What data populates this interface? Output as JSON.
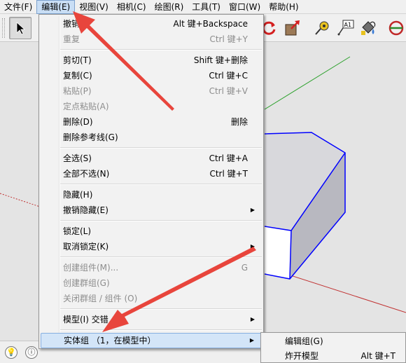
{
  "menubar": {
    "items": [
      {
        "label": "文件(F)"
      },
      {
        "label": "编辑(E)"
      },
      {
        "label": "视图(V)"
      },
      {
        "label": "相机(C)"
      },
      {
        "label": "绘图(R)"
      },
      {
        "label": "工具(T)"
      },
      {
        "label": "窗口(W)"
      },
      {
        "label": "帮助(H)"
      }
    ]
  },
  "toolbar": {
    "icons": [
      "select-arrow-icon",
      "orbit-icon",
      "push-pull-icon",
      "tape-measure-icon",
      "text-label-icon",
      "paint-bucket-icon",
      "rotate-icon"
    ],
    "text_tool_label": "A1"
  },
  "edit_menu": {
    "items": [
      {
        "label": "撤销组",
        "shortcut": "Alt 键+Backspace",
        "disabled": false
      },
      {
        "label": "重复",
        "shortcut": "Ctrl 键+Y",
        "disabled": true
      },
      {
        "label": "剪切(T)",
        "shortcut": "Shift 键+删除",
        "disabled": false
      },
      {
        "label": "复制(C)",
        "shortcut": "Ctrl 键+C",
        "disabled": false
      },
      {
        "label": "粘贴(P)",
        "shortcut": "Ctrl 键+V",
        "disabled": true
      },
      {
        "label": "定点粘贴(A)",
        "shortcut": "",
        "disabled": true
      },
      {
        "label": "删除(D)",
        "shortcut": "删除",
        "disabled": false
      },
      {
        "label": "删除参考线(G)",
        "shortcut": "",
        "disabled": false
      },
      {
        "label": "全选(S)",
        "shortcut": "Ctrl 键+A",
        "disabled": false
      },
      {
        "label": "全部不选(N)",
        "shortcut": "Ctrl 键+T",
        "disabled": false
      },
      {
        "label": "隐藏(H)",
        "shortcut": "",
        "disabled": false
      },
      {
        "label": "撤销隐藏(E)",
        "shortcut": "",
        "disabled": false,
        "submenu": true
      },
      {
        "label": "锁定(L)",
        "shortcut": "",
        "disabled": false
      },
      {
        "label": "取消锁定(K)",
        "shortcut": "",
        "disabled": false,
        "submenu": true
      },
      {
        "label": "创建组件(M)...",
        "shortcut": "G",
        "disabled": true
      },
      {
        "label": "创建群组(G)",
        "shortcut": "",
        "disabled": true
      },
      {
        "label": "关闭群组 / 组件 (O)",
        "shortcut": "",
        "disabled": true
      },
      {
        "label": "模型(I) 交错",
        "shortcut": "",
        "disabled": false,
        "submenu": true
      },
      {
        "label": "实体组 （1，在模型中）",
        "shortcut": "",
        "disabled": false,
        "submenu": true,
        "highlighted": true
      }
    ]
  },
  "submenu": {
    "items": [
      {
        "label": "编辑组(G)",
        "shortcut": ""
      },
      {
        "label": "炸开模型",
        "shortcut": "Alt 键+T"
      }
    ]
  },
  "statusbar": {
    "icons": [
      "hint-bulb-icon",
      "info-icon"
    ]
  },
  "colors": {
    "annotation_arrow": "#e8453c",
    "selection_edge": "#0000ff",
    "menu_highlight": "#d3e5f8",
    "axis_green": "#2aa02a",
    "axis_red": "#c03030"
  }
}
